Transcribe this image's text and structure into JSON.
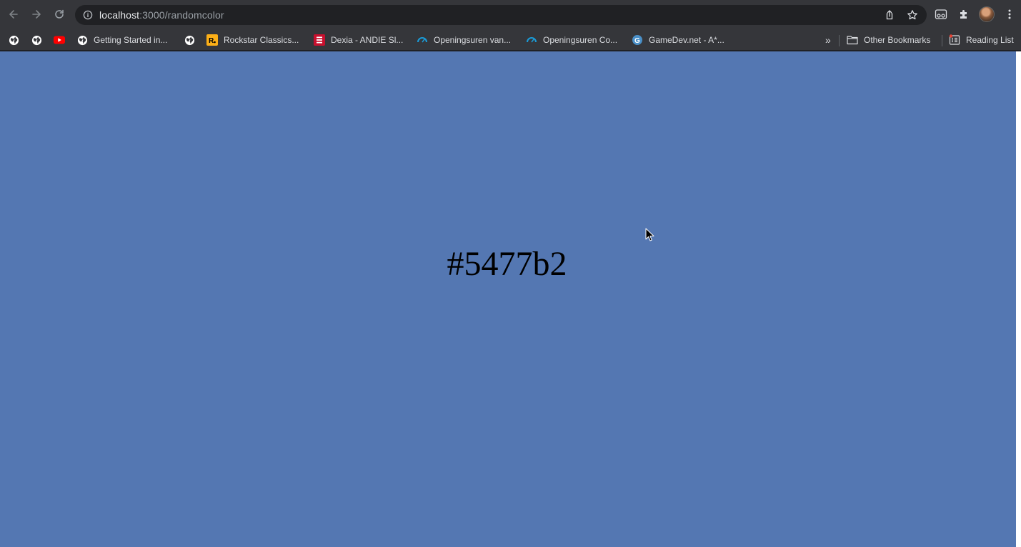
{
  "browser": {
    "url_host": "localhost",
    "url_path": ":3000/randomcolor",
    "bookmarks": [
      {
        "label": "",
        "icon": "globe-icon"
      },
      {
        "label": "",
        "icon": "globe-icon"
      },
      {
        "label": "",
        "icon": "youtube-icon"
      },
      {
        "label": "Getting Started in...",
        "icon": "globe-icon"
      },
      {
        "label": "",
        "icon": "globe-icon"
      },
      {
        "label": "Rockstar Classics...",
        "icon": "rockstar-icon"
      },
      {
        "label": "Dexia - ANDIE Sl...",
        "icon": "dexia-icon"
      },
      {
        "label": "Openingsuren van...",
        "icon": "gauge-icon"
      },
      {
        "label": "Openingsuren Co...",
        "icon": "gauge-icon"
      },
      {
        "label": "GameDev.net - A*...",
        "icon": "gamedev-icon"
      }
    ],
    "overflow_label": "»",
    "other_bookmarks_label": "Other Bookmarks",
    "reading_list_label": "Reading List"
  },
  "page": {
    "background_color": "#5477b2",
    "color_code": "#5477b2"
  }
}
